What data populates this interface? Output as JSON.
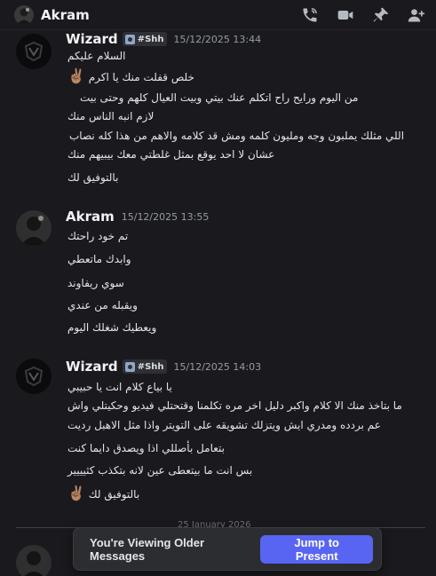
{
  "header": {
    "title": "Akram",
    "icons": [
      "voice-call-icon",
      "video-call-icon",
      "pin-icon",
      "add-friends-icon"
    ]
  },
  "messages": [
    {
      "author": "Wizard",
      "tag": "#Shh",
      "timestamp": "15/12/2025 13:44",
      "lines": [
        "السلام عليكم",
        "خلص قفلت منك يا اكرم",
        "من اليوم ورايح راح اتكلم عنك بيتي وبيت العيال كلهم وحتى بيت",
        "لازم انبه الناس منك",
        "اللي مثلك يملبون وجه ومليون كلمه ومش قد كلامه والاهم من هذا كله نصاب",
        "عشان لا احد يوقع بمثل غلطتي معك بيبيهم منك",
        "بالتوفيق لك"
      ]
    },
    {
      "author": "Akram",
      "timestamp": "15/12/2025 13:55",
      "lines": [
        "تم خود راحتك",
        "وابدك ماتعطي",
        "سوي ريفاوند",
        "ويقبله من عندي",
        "ويعطيك شغلك اليوم"
      ]
    },
    {
      "author": "Wizard",
      "tag": "#Shh",
      "timestamp": "15/12/2025 14:03",
      "lines": [
        "يا بياع كلام انت يا حبيبي",
        "ما بتاخذ منك الا كلام واكبر دليل اخر مره تكلمنا وقتحتلي فيديو وحكيتلي واش",
        "عم بردده ومدري ايش ويتزلك تشويقه على التويتر واذا مثل الاهبل رديت",
        "بتعامل بأصللي اذا ويصدق دايما كنت",
        "بس انت ما بيتعطى عين لانه بتكذب كثيييير",
        "بالتوفيق لك"
      ]
    }
  ],
  "divider": {
    "label": "25 January 2026"
  },
  "older_bar": {
    "text": "You're Viewing Older Messages",
    "button": "Jump to Present"
  },
  "accent_color": "#5865f2"
}
